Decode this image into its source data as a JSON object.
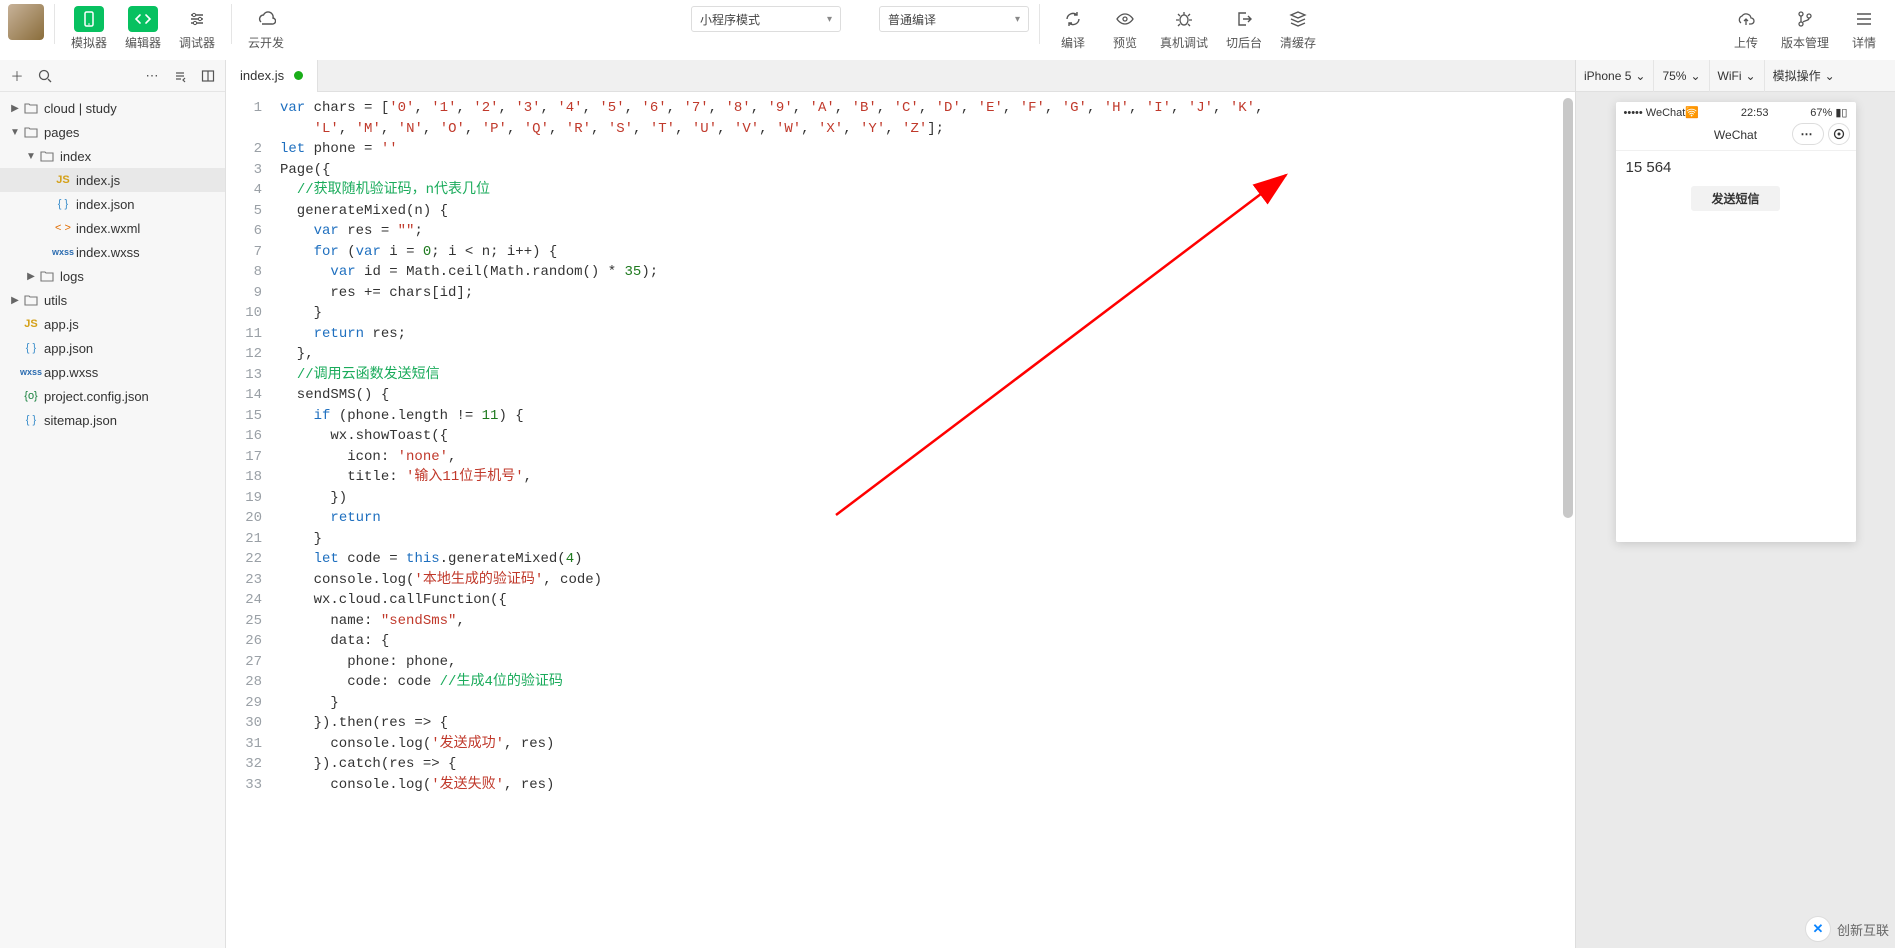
{
  "topbar": {
    "simulator": "模拟器",
    "editor": "编辑器",
    "debugger": "调试器",
    "cloud": "云开发",
    "modeCombo": "小程序模式",
    "compileCombo": "普通编译",
    "compile": "编译",
    "preview": "预览",
    "realDebug": "真机调试",
    "background": "切后台",
    "clearCache": "清缓存",
    "upload": "上传",
    "version": "版本管理",
    "details": "详情"
  },
  "sidebar": {
    "tree": [
      {
        "type": "folder",
        "label": "cloud | study",
        "depth": 0,
        "expanded": false,
        "twist": "▶"
      },
      {
        "type": "folder",
        "label": "pages",
        "depth": 0,
        "expanded": true,
        "twist": "▼"
      },
      {
        "type": "folder",
        "label": "index",
        "depth": 1,
        "expanded": true,
        "twist": "▼"
      },
      {
        "type": "file",
        "label": "index.js",
        "depth": 2,
        "icon": "js",
        "selected": true
      },
      {
        "type": "file",
        "label": "index.json",
        "depth": 2,
        "icon": "json"
      },
      {
        "type": "file",
        "label": "index.wxml",
        "depth": 2,
        "icon": "wxml"
      },
      {
        "type": "file",
        "label": "index.wxss",
        "depth": 2,
        "icon": "wxss"
      },
      {
        "type": "folder",
        "label": "logs",
        "depth": 1,
        "expanded": false,
        "twist": "▶"
      },
      {
        "type": "folder",
        "label": "utils",
        "depth": 0,
        "expanded": false,
        "twist": "▶"
      },
      {
        "type": "file",
        "label": "app.js",
        "depth": 0,
        "icon": "js"
      },
      {
        "type": "file",
        "label": "app.json",
        "depth": 0,
        "icon": "json"
      },
      {
        "type": "file",
        "label": "app.wxss",
        "depth": 0,
        "icon": "wxss"
      },
      {
        "type": "file",
        "label": "project.config.json",
        "depth": 0,
        "icon": "cfg"
      },
      {
        "type": "file",
        "label": "sitemap.json",
        "depth": 0,
        "icon": "json"
      }
    ]
  },
  "tabs": {
    "active": "index.js"
  },
  "code": {
    "lines": [
      [
        {
          "c": "kw",
          "t": "var"
        },
        {
          "t": " chars = ["
        },
        {
          "c": "str",
          "t": "'0'"
        },
        {
          "t": ", "
        },
        {
          "c": "str",
          "t": "'1'"
        },
        {
          "t": ", "
        },
        {
          "c": "str",
          "t": "'2'"
        },
        {
          "t": ", "
        },
        {
          "c": "str",
          "t": "'3'"
        },
        {
          "t": ", "
        },
        {
          "c": "str",
          "t": "'4'"
        },
        {
          "t": ", "
        },
        {
          "c": "str",
          "t": "'5'"
        },
        {
          "t": ", "
        },
        {
          "c": "str",
          "t": "'6'"
        },
        {
          "t": ", "
        },
        {
          "c": "str",
          "t": "'7'"
        },
        {
          "t": ", "
        },
        {
          "c": "str",
          "t": "'8'"
        },
        {
          "t": ", "
        },
        {
          "c": "str",
          "t": "'9'"
        },
        {
          "t": ", "
        },
        {
          "c": "str",
          "t": "'A'"
        },
        {
          "t": ", "
        },
        {
          "c": "str",
          "t": "'B'"
        },
        {
          "t": ", "
        },
        {
          "c": "str",
          "t": "'C'"
        },
        {
          "t": ", "
        },
        {
          "c": "str",
          "t": "'D'"
        },
        {
          "t": ", "
        },
        {
          "c": "str",
          "t": "'E'"
        },
        {
          "t": ", "
        },
        {
          "c": "str",
          "t": "'F'"
        },
        {
          "t": ", "
        },
        {
          "c": "str",
          "t": "'G'"
        },
        {
          "t": ", "
        },
        {
          "c": "str",
          "t": "'H'"
        },
        {
          "t": ", "
        },
        {
          "c": "str",
          "t": "'I'"
        },
        {
          "t": ", "
        },
        {
          "c": "str",
          "t": "'J'"
        },
        {
          "t": ", "
        },
        {
          "c": "str",
          "t": "'K'"
        },
        {
          "t": ","
        }
      ],
      [
        {
          "c": "str",
          "t": "'L'"
        },
        {
          "t": ", "
        },
        {
          "c": "str",
          "t": "'M'"
        },
        {
          "t": ", "
        },
        {
          "c": "str",
          "t": "'N'"
        },
        {
          "t": ", "
        },
        {
          "c": "str",
          "t": "'O'"
        },
        {
          "t": ", "
        },
        {
          "c": "str",
          "t": "'P'"
        },
        {
          "t": ", "
        },
        {
          "c": "str",
          "t": "'Q'"
        },
        {
          "t": ", "
        },
        {
          "c": "str",
          "t": "'R'"
        },
        {
          "t": ", "
        },
        {
          "c": "str",
          "t": "'S'"
        },
        {
          "t": ", "
        },
        {
          "c": "str",
          "t": "'T'"
        },
        {
          "t": ", "
        },
        {
          "c": "str",
          "t": "'U'"
        },
        {
          "t": ", "
        },
        {
          "c": "str",
          "t": "'V'"
        },
        {
          "t": ", "
        },
        {
          "c": "str",
          "t": "'W'"
        },
        {
          "t": ", "
        },
        {
          "c": "str",
          "t": "'X'"
        },
        {
          "t": ", "
        },
        {
          "c": "str",
          "t": "'Y'"
        },
        {
          "t": ", "
        },
        {
          "c": "str",
          "t": "'Z'"
        },
        {
          "t": "];"
        }
      ],
      [
        {
          "c": "kw",
          "t": "let"
        },
        {
          "t": " phone = "
        },
        {
          "c": "str",
          "t": "''"
        }
      ],
      [
        {
          "c": "id",
          "t": "Page"
        },
        {
          "t": "({"
        }
      ],
      [
        {
          "t": "  "
        },
        {
          "c": "cm",
          "t": "//获取随机验证码，n代表几位"
        }
      ],
      [
        {
          "t": "  generateMixed(n) {"
        }
      ],
      [
        {
          "t": "    "
        },
        {
          "c": "kw",
          "t": "var"
        },
        {
          "t": " res = "
        },
        {
          "c": "str",
          "t": "\"\""
        },
        {
          "t": ";"
        }
      ],
      [
        {
          "t": "    "
        },
        {
          "c": "kw",
          "t": "for"
        },
        {
          "t": " ("
        },
        {
          "c": "kw",
          "t": "var"
        },
        {
          "t": " i = "
        },
        {
          "c": "num",
          "t": "0"
        },
        {
          "t": "; i < n; i++) {"
        }
      ],
      [
        {
          "t": "      "
        },
        {
          "c": "kw",
          "t": "var"
        },
        {
          "t": " id = "
        },
        {
          "c": "id",
          "t": "Math"
        },
        {
          "t": ".ceil("
        },
        {
          "c": "id",
          "t": "Math"
        },
        {
          "t": ".random() * "
        },
        {
          "c": "num",
          "t": "35"
        },
        {
          "t": ");"
        }
      ],
      [
        {
          "t": "      res += chars[id];"
        }
      ],
      [
        {
          "t": "    }"
        }
      ],
      [
        {
          "t": "    "
        },
        {
          "c": "kw",
          "t": "return"
        },
        {
          "t": " res;"
        }
      ],
      [
        {
          "t": "  },"
        }
      ],
      [
        {
          "t": "  "
        },
        {
          "c": "cm",
          "t": "//调用云函数发送短信"
        }
      ],
      [
        {
          "t": "  sendSMS() {"
        }
      ],
      [
        {
          "t": "    "
        },
        {
          "c": "kw",
          "t": "if"
        },
        {
          "t": " (phone.length != "
        },
        {
          "c": "num",
          "t": "11"
        },
        {
          "t": ") {"
        }
      ],
      [
        {
          "t": "      wx.showToast({"
        }
      ],
      [
        {
          "t": "        icon: "
        },
        {
          "c": "str",
          "t": "'none'"
        },
        {
          "t": ","
        }
      ],
      [
        {
          "t": "        title: "
        },
        {
          "c": "str",
          "t": "'输入11位手机号'"
        },
        {
          "t": ","
        }
      ],
      [
        {
          "t": "      })"
        }
      ],
      [
        {
          "t": "      "
        },
        {
          "c": "kw",
          "t": "return"
        }
      ],
      [
        {
          "t": "    }"
        }
      ],
      [
        {
          "t": "    "
        },
        {
          "c": "kw",
          "t": "let"
        },
        {
          "t": " code = "
        },
        {
          "c": "kw",
          "t": "this"
        },
        {
          "t": ".generateMixed("
        },
        {
          "c": "num",
          "t": "4"
        },
        {
          "t": ")"
        }
      ],
      [
        {
          "t": "    console.log("
        },
        {
          "c": "str",
          "t": "'本地生成的验证码'"
        },
        {
          "t": ", code)"
        }
      ],
      [
        {
          "t": "    wx.cloud.callFunction({"
        }
      ],
      [
        {
          "t": "      name: "
        },
        {
          "c": "str",
          "t": "\"sendSms\""
        },
        {
          "t": ","
        }
      ],
      [
        {
          "t": "      data: {"
        }
      ],
      [
        {
          "t": "        phone: phone,"
        }
      ],
      [
        {
          "t": "        code: code "
        },
        {
          "c": "cm",
          "t": "//生成4位的验证码"
        }
      ],
      [
        {
          "t": "      }"
        }
      ],
      [
        {
          "t": "    }).then(res => {"
        }
      ],
      [
        {
          "t": "      console.log("
        },
        {
          "c": "str",
          "t": "'发送成功'"
        },
        {
          "t": ", res)"
        }
      ],
      [
        {
          "t": "    }).catch(res => {"
        }
      ],
      [
        {
          "t": "      console.log("
        },
        {
          "c": "str",
          "t": "'发送失败'"
        },
        {
          "t": ", res)"
        }
      ]
    ],
    "wrapIndent": "    "
  },
  "simbar": {
    "device": "iPhone 5",
    "zoom": "75%",
    "network": "WiFi",
    "ops": "模拟操作"
  },
  "phone": {
    "carrier": "••••• WeChat",
    "signalIcon": "📶",
    "time": "22:53",
    "battery": "67%",
    "navTitle": "WeChat",
    "inputValue": "15            564",
    "button": "发送短信"
  },
  "watermark": "创新互联"
}
